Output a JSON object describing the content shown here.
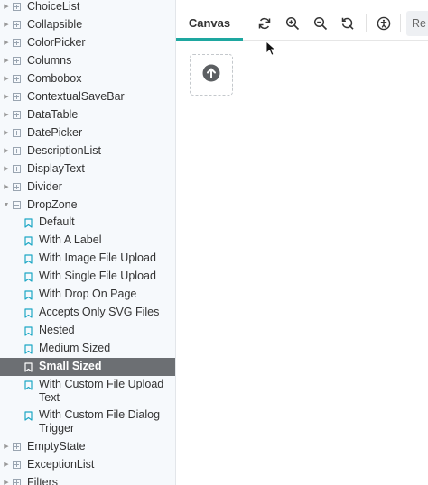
{
  "sidebar": {
    "groups_before": [
      {
        "label": "ChoiceList"
      },
      {
        "label": "Collapsible"
      },
      {
        "label": "ColorPicker"
      },
      {
        "label": "Columns"
      },
      {
        "label": "Combobox"
      },
      {
        "label": "ContextualSaveBar"
      },
      {
        "label": "DataTable"
      },
      {
        "label": "DatePicker"
      },
      {
        "label": "DescriptionList"
      },
      {
        "label": "DisplayText"
      },
      {
        "label": "Divider"
      }
    ],
    "open_group": {
      "label": "DropZone"
    },
    "stories": [
      {
        "label": "Default",
        "selected": false
      },
      {
        "label": "With A Label",
        "selected": false
      },
      {
        "label": "With Image File Upload",
        "selected": false
      },
      {
        "label": "With Single File Upload",
        "selected": false
      },
      {
        "label": "With Drop On Page",
        "selected": false
      },
      {
        "label": "Accepts Only SVG Files",
        "selected": false
      },
      {
        "label": "Nested",
        "selected": false
      },
      {
        "label": "Medium Sized",
        "selected": false
      },
      {
        "label": "Small Sized",
        "selected": true
      },
      {
        "label": "With Custom File Upload Text",
        "selected": false
      },
      {
        "label": "With Custom File Dialog Trigger",
        "selected": false
      }
    ],
    "groups_after": [
      {
        "label": "EmptyState"
      },
      {
        "label": "ExceptionList"
      },
      {
        "label": "Filters"
      }
    ]
  },
  "toolbar": {
    "canvas_tab": "Canvas",
    "next_tab_partial": "Re",
    "icons": [
      "reload-icon",
      "zoom-in-icon",
      "zoom-out-icon",
      "zoom-reset-icon",
      "accessibility-icon"
    ]
  },
  "colors": {
    "accent": "#1ea7a0",
    "bookmark": "#1ea7c5",
    "selected_bg": "#6c6f73",
    "upload_icon": "#5c5f62"
  }
}
